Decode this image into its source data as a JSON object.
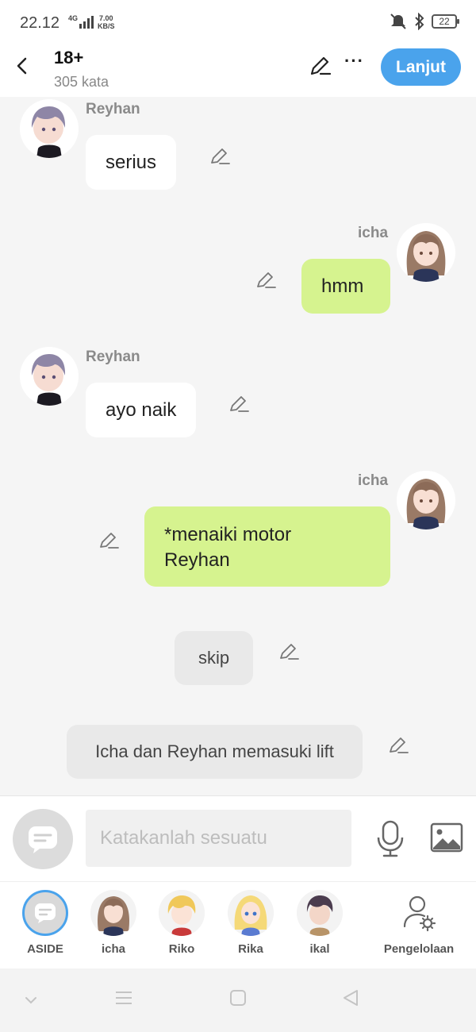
{
  "status_bar": {
    "time": "22.12",
    "network": "4G",
    "speed_value": "7.00",
    "speed_unit": "KB/S",
    "battery": "22"
  },
  "header": {
    "title": "18+",
    "word_count": "305 kata",
    "next_label": "Lanjut"
  },
  "messages": [
    {
      "side": "left",
      "name": "Reyhan",
      "text": "serius"
    },
    {
      "side": "right",
      "name": "icha",
      "text": "hmm"
    },
    {
      "side": "left",
      "name": "Reyhan",
      "text": "ayo naik"
    },
    {
      "side": "right",
      "name": "icha",
      "text_line1": "*menaiki motor",
      "text_line2": "Reyhan"
    },
    {
      "side": "system",
      "text": "skip"
    },
    {
      "side": "system",
      "text": "Icha dan Reyhan memasuki lift"
    }
  ],
  "input": {
    "placeholder": "Katakanlah sesuatu"
  },
  "characters": [
    {
      "label": "ASIDE"
    },
    {
      "label": "icha"
    },
    {
      "label": "Riko"
    },
    {
      "label": "Rika"
    },
    {
      "label": "ikal"
    },
    {
      "label": "Pengelolaan"
    }
  ],
  "colors": {
    "accent": "#4aa3ec",
    "own_bubble": "#d6f38f",
    "other_bubble": "#ffffff",
    "system_bubble": "#e9e9e9"
  }
}
